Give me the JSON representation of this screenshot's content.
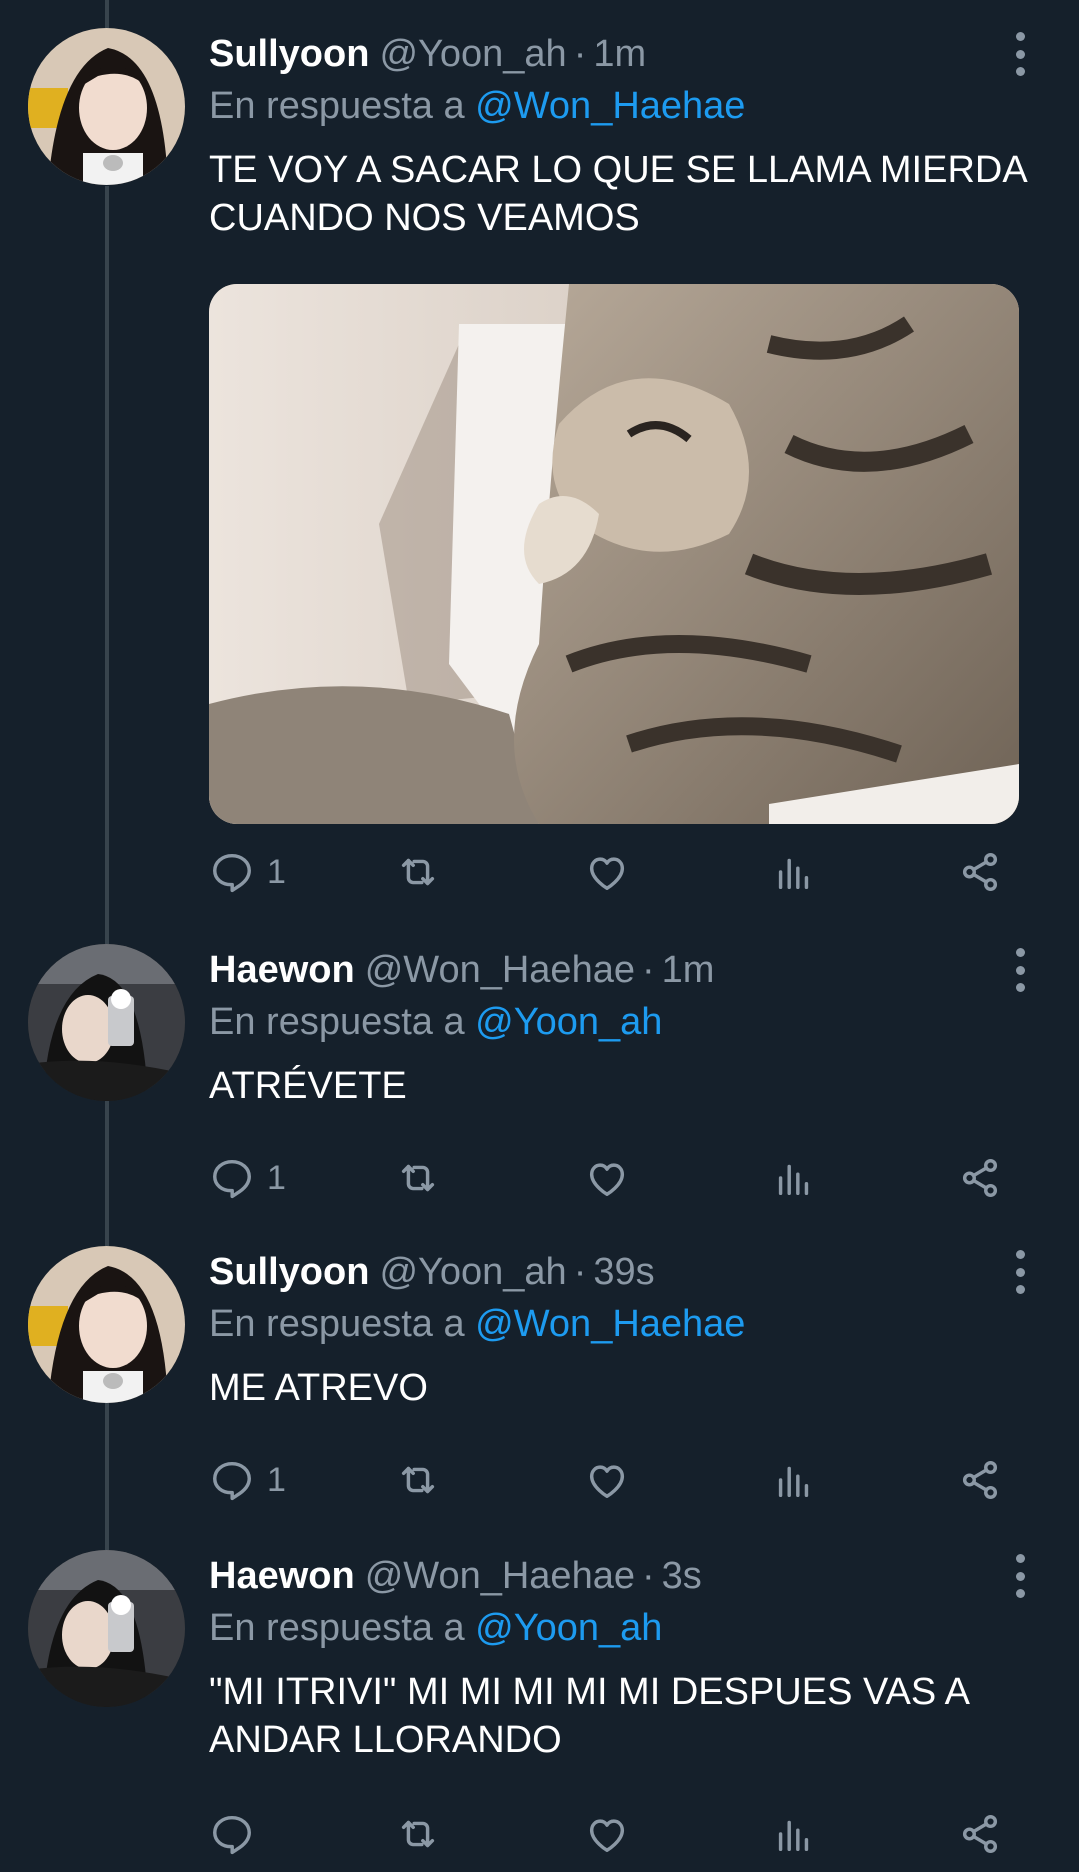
{
  "reply_prefix": "En respuesta a",
  "dot": "·",
  "colors": {
    "background": "#15202b",
    "text": "#ffffff",
    "secondary": "#8b98a5",
    "link": "#1d9bf0",
    "thread_line": "#38444d"
  },
  "tweets": [
    {
      "name": "Sullyoon",
      "handle": "@Yoon_ah",
      "time": "1m",
      "reply_to": "@Won_Haehae",
      "text": "TE VOY A SACAR LO QUE SE LLAMA MIERDA CUANDO NOS VEAMOS",
      "has_media": true,
      "media_description": "cat-photo",
      "reply_count": "1"
    },
    {
      "name": "Haewon",
      "handle": "@Won_Haehae",
      "time": "1m",
      "reply_to": "@Yoon_ah",
      "text": "ATRÉVETE",
      "reply_count": "1"
    },
    {
      "name": "Sullyoon",
      "handle": "@Yoon_ah",
      "time": "39s",
      "reply_to": "@Won_Haehae",
      "text": "ME ATREVO",
      "reply_count": "1"
    },
    {
      "name": "Haewon",
      "handle": "@Won_Haehae",
      "time": "3s",
      "reply_to": "@Yoon_ah",
      "text": "\"MI ITRIVI\" MI MI MI MI MI DESPUES VAS A ANDAR LLORANDO",
      "reply_count": ""
    }
  ],
  "icons": [
    "reply-icon",
    "retweet-icon",
    "like-icon",
    "views-icon",
    "share-icon",
    "more-icon"
  ]
}
